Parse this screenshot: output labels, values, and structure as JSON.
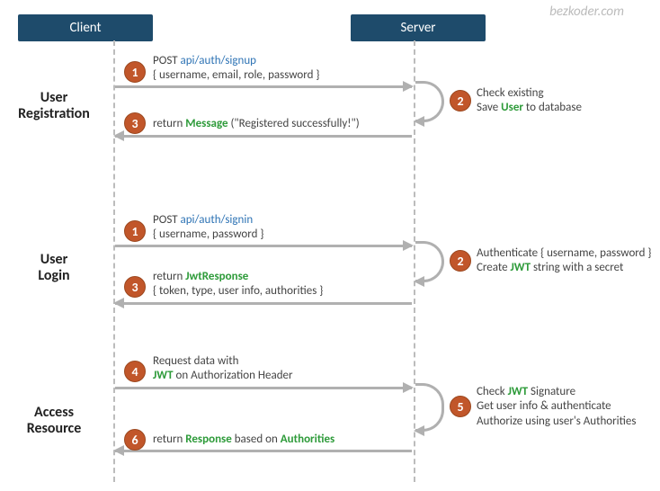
{
  "watermark": "bezkoder.com",
  "headers": {
    "client": "Client",
    "server": "Server"
  },
  "sections": {
    "registration": "User\nRegistration",
    "login": "User\nLogin",
    "access": "Access\nResource"
  },
  "steps": {
    "reg1_method": "POST ",
    "reg1_endpoint": "api/auth/signup",
    "reg1_body": "{ username, email, role, password }",
    "reg2_line1": "Check existing",
    "reg2_line2a": "Save ",
    "reg2_user": "User",
    "reg2_line2b": " to database",
    "reg3_a": "return ",
    "reg3_msg": "Message",
    "reg3_b": " (\"Registered successfully!\")",
    "login1_method": "POST ",
    "login1_endpoint": "api/auth/signin",
    "login1_body": "{ username, password }",
    "login2_line1": "Authenticate { username, password }",
    "login2_line2a": "Create ",
    "login2_jwt": "JWT",
    "login2_line2b": " string with a secret",
    "login3_a": "return ",
    "login3_resp": "JwtResponse",
    "login3_body": "{ token, type, user info, authorities }",
    "acc4_line1": "Request  data with",
    "acc4_jwt": "JWT",
    "acc4_line2b": " on Authorization Header",
    "acc5_line1a": "Check ",
    "acc5_jwt": "JWT",
    "acc5_line1b": " Signature",
    "acc5_line2": "Get user info & authenticate",
    "acc5_line3": "Authorize using user's Authorities",
    "acc6_a": "return ",
    "acc6_resp": "Response",
    "acc6_b": " based on ",
    "acc6_auth": "Authorities"
  },
  "nums": {
    "n1": "1",
    "n2": "2",
    "n3": "3",
    "n4": "4",
    "n5": "5",
    "n6": "6"
  }
}
